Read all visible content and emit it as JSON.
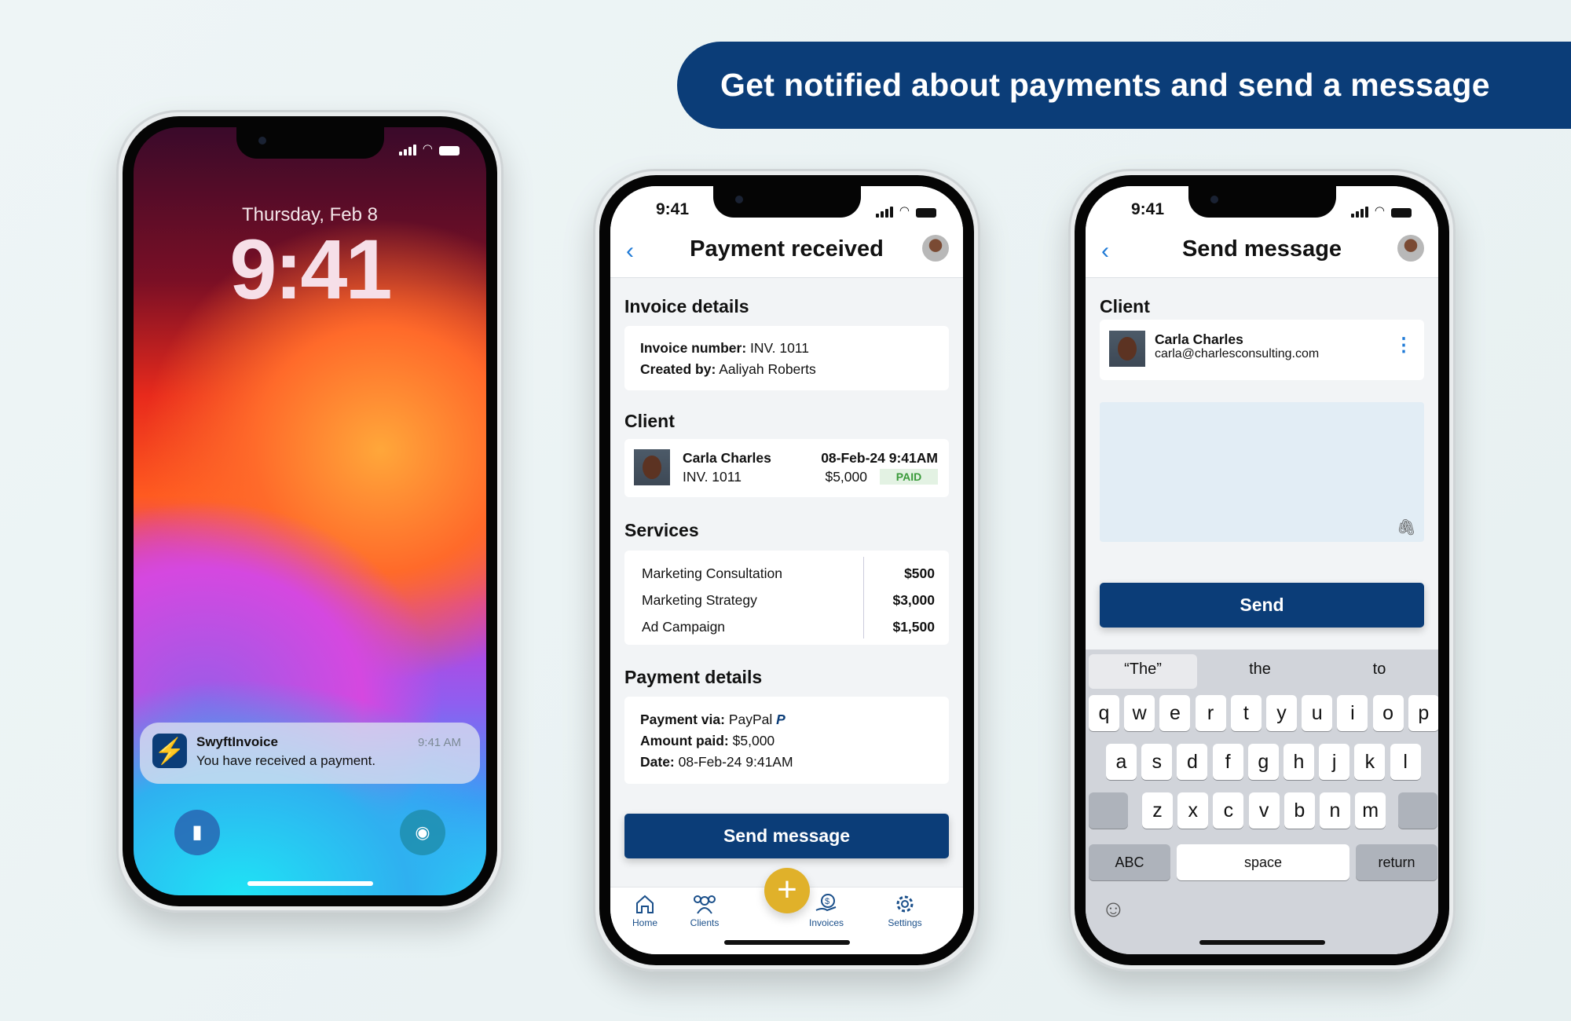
{
  "banner": {
    "text": "Get notified about payments and send a message"
  },
  "colors": {
    "brand": "#0b3d78",
    "accent": "#e0b12a",
    "link": "#1f7ad6",
    "paid_bg": "#e3f2e3",
    "paid_text": "#3a9a3a"
  },
  "lock_screen": {
    "date": "Thursday, Feb 8",
    "time": "9:41",
    "notification": {
      "app": "SwyftInvoice",
      "message": "You have received a payment.",
      "time": "9:41 AM",
      "icon": "lightning-bolt-icon"
    },
    "buttons": [
      "flashlight-icon",
      "camera-icon"
    ]
  },
  "payment_screen": {
    "status_time": "9:41",
    "title": "Payment received",
    "invoice_heading": "Invoice details",
    "invoice_number_label": "Invoice number:",
    "invoice_number": "INV. 1011",
    "created_by_label": "Created by:",
    "created_by": "Aaliyah Roberts",
    "client_heading": "Client",
    "client": {
      "name": "Carla Charles",
      "invoice": "INV. 1011",
      "datetime": "08-Feb-24 9:41AM",
      "amount": "$5,000",
      "status": "PAID"
    },
    "services_heading": "Services",
    "services": [
      {
        "name": "Marketing Consultation",
        "price": "$500"
      },
      {
        "name": "Marketing Strategy",
        "price": "$3,000"
      },
      {
        "name": "Ad Campaign",
        "price": "$1,500"
      }
    ],
    "payment_heading": "Payment details",
    "payment_via_label": "Payment via:",
    "payment_via": "PayPal",
    "amount_paid_label": "Amount paid:",
    "amount_paid": "$5,000",
    "date_label": "Date:",
    "date": "08-Feb-24 9:41AM",
    "send_button": "Send message",
    "tabs": [
      {
        "label": "Home",
        "icon": "home-icon"
      },
      {
        "label": "Clients",
        "icon": "clients-icon"
      },
      {
        "label": "Invoices",
        "icon": "invoices-icon"
      },
      {
        "label": "Settings",
        "icon": "settings-icon"
      }
    ]
  },
  "message_screen": {
    "status_time": "9:41",
    "title": "Send message",
    "client_heading": "Client",
    "client": {
      "name": "Carla Charles",
      "email": "carla@charlesconsulting.com"
    },
    "message_value": "",
    "send_button": "Send",
    "suggestions": [
      "“The”",
      "the",
      "to"
    ],
    "keyboard": {
      "row1": [
        "q",
        "w",
        "e",
        "r",
        "t",
        "y",
        "u",
        "i",
        "o",
        "p"
      ],
      "row2": [
        "a",
        "s",
        "d",
        "f",
        "g",
        "h",
        "j",
        "k",
        "l"
      ],
      "row3": [
        "z",
        "x",
        "c",
        "v",
        "b",
        "n",
        "m"
      ],
      "abc": "ABC",
      "space": "space",
      "return": "return"
    }
  }
}
